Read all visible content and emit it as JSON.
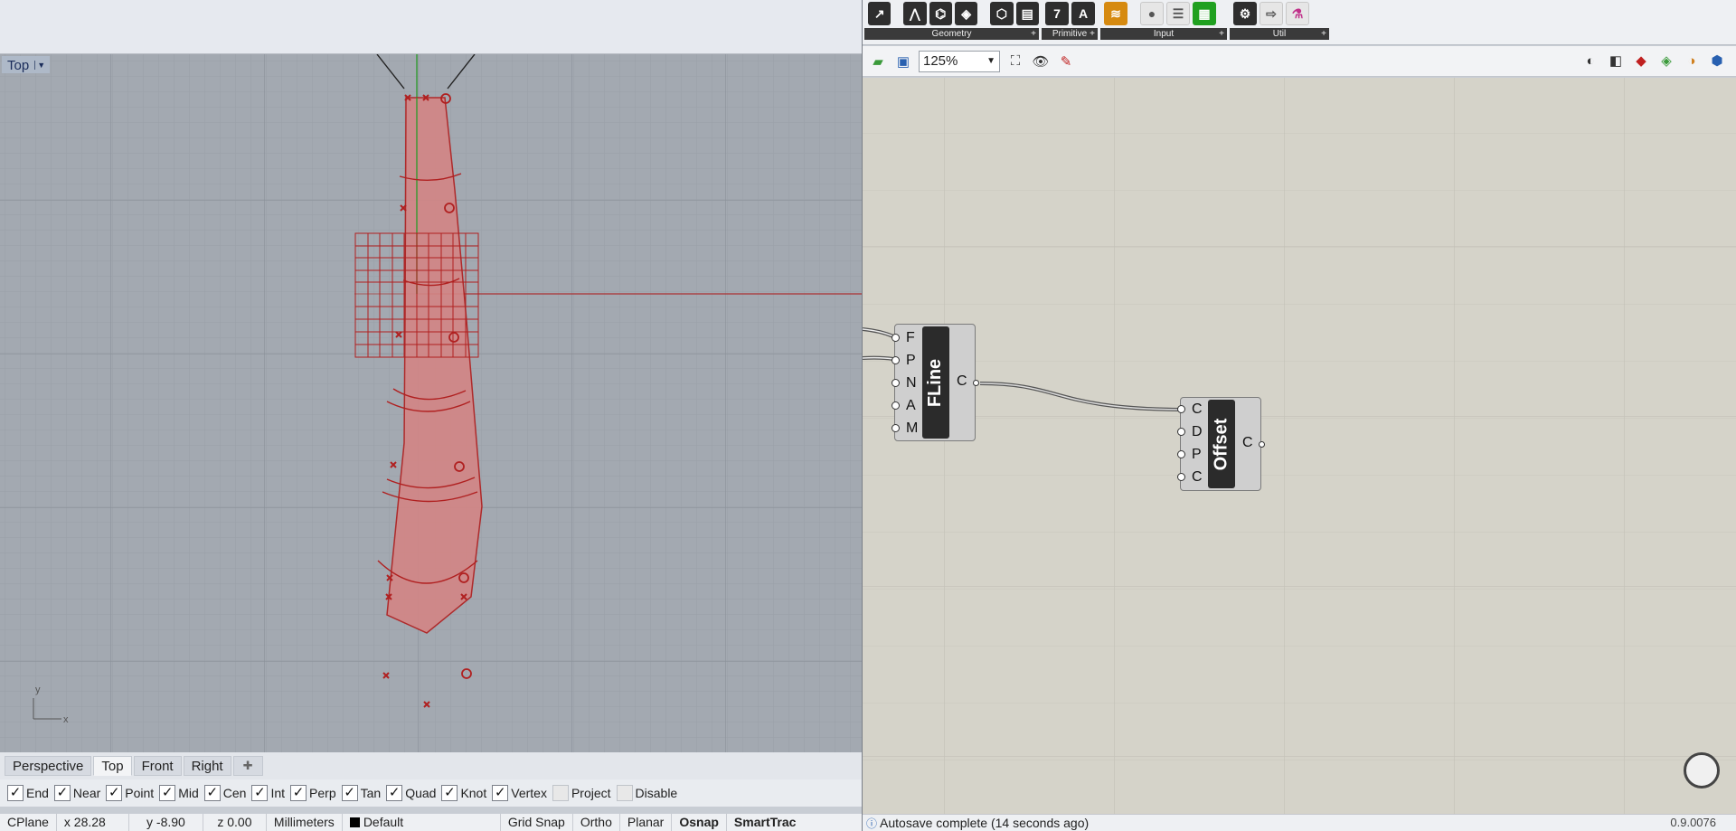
{
  "rhino": {
    "viewport": {
      "title": "Top",
      "axis_y": "y",
      "axis_x": "x"
    },
    "tabs": [
      {
        "label": "Perspective",
        "active": false
      },
      {
        "label": "Top",
        "active": true
      },
      {
        "label": "Front",
        "active": false
      },
      {
        "label": "Right",
        "active": false
      }
    ],
    "add_tab_icon": "plus-icon",
    "osnaps": [
      {
        "label": "End",
        "checked": true
      },
      {
        "label": "Near",
        "checked": true
      },
      {
        "label": "Point",
        "checked": true
      },
      {
        "label": "Mid",
        "checked": true
      },
      {
        "label": "Cen",
        "checked": true
      },
      {
        "label": "Int",
        "checked": true
      },
      {
        "label": "Perp",
        "checked": true
      },
      {
        "label": "Tan",
        "checked": true
      },
      {
        "label": "Quad",
        "checked": true
      },
      {
        "label": "Knot",
        "checked": true
      },
      {
        "label": "Vertex",
        "checked": true
      },
      {
        "label": "Project",
        "checked": false
      },
      {
        "label": "Disable",
        "checked": false
      }
    ],
    "status": {
      "cplane": "CPlane",
      "x": "x 28.28",
      "y": "y -8.90",
      "z": "z 0.00",
      "units": "Millimeters",
      "layer": "Default",
      "grid_snap": "Grid Snap",
      "ortho": "Ortho",
      "planar": "Planar",
      "osnap": "Osnap",
      "smarttrack": "SmartTrac"
    }
  },
  "grasshopper": {
    "ribbon_groups": [
      {
        "label": "Geometry"
      },
      {
        "label": "Primitive"
      },
      {
        "label": "Input"
      },
      {
        "label": "Util"
      }
    ],
    "primitive_icons": [
      "7",
      "A"
    ],
    "zoom": "125%",
    "components": {
      "fline": {
        "name": "FLine",
        "inputs": [
          "F",
          "P",
          "N",
          "A",
          "M"
        ],
        "output": "C"
      },
      "offset": {
        "name": "Offset",
        "inputs": [
          "C",
          "D",
          "P",
          "C"
        ],
        "output": "C"
      }
    },
    "status": "Autosave complete (14 seconds ago)",
    "version": "0.9.0076",
    "colors": {
      "canvas": "#d5d3c9",
      "selection_red": "#b02020",
      "viewport_bg": "#a3a9b1"
    }
  }
}
